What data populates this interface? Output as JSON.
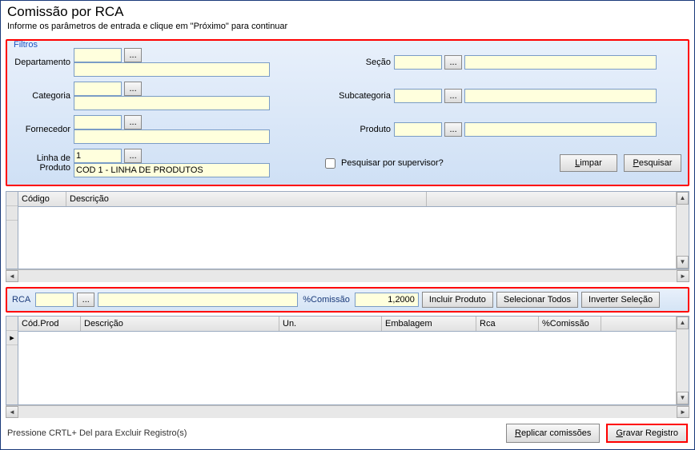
{
  "header": {
    "title": "Comissão por RCA",
    "subtitle": "Informe os parâmetros de entrada e clique em \"Próximo\" para continuar"
  },
  "filters": {
    "legend": "Filtros",
    "left": [
      {
        "label": "Departamento",
        "code": "",
        "desc": ""
      },
      {
        "label": "Categoria",
        "code": "",
        "desc": ""
      },
      {
        "label": "Fornecedor",
        "code": "",
        "desc": ""
      }
    ],
    "linha": {
      "label1": "Linha de",
      "label2": "Produto",
      "code": "1",
      "desc": "COD 1 - LINHA DE PRODUTOS"
    },
    "right": [
      {
        "label": "Seção",
        "code": "",
        "desc": ""
      },
      {
        "label": "Subcategoria",
        "code": "",
        "desc": ""
      },
      {
        "label": "Produto",
        "code": "",
        "desc": ""
      }
    ],
    "supervisor_label": "Pesquisar por supervisor?",
    "btn_limpar": "Limpar",
    "btn_pesquisar": "Pesquisar",
    "lookup": "..."
  },
  "grid1": {
    "cols": {
      "codigo": "Código",
      "descricao": "Descrição"
    }
  },
  "mid": {
    "rca_label": "RCA",
    "rca_code": "",
    "rca_desc": "",
    "lookup": "...",
    "comm_label": "%Comissão",
    "comm_value": "1,2000",
    "btn_incluir": "Incluir Produto",
    "btn_selecionar": "Selecionar Todos",
    "btn_inverter": "Inverter Seleção"
  },
  "grid2": {
    "cols": {
      "codprod": "Cód.Prod",
      "descricao": "Descrição",
      "un": "Un.",
      "embalagem": "Embalagem",
      "rca": "Rca",
      "comissao": "%Comissão"
    },
    "indicator": "▸"
  },
  "footer": {
    "hint": "Pressione CRTL+ Del para Excluir Registro(s)",
    "btn_replicar": "Replicar comissões",
    "btn_gravar": "Gravar Registro"
  }
}
